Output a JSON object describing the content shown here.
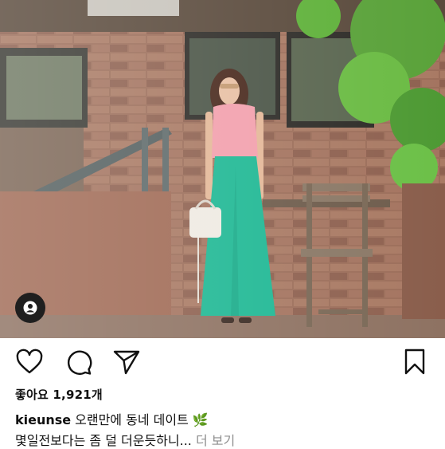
{
  "post": {
    "likes_label": "좋아요 1,921개",
    "username": "kieunse",
    "caption": "오랜만에 동네 데이트",
    "caption_emoji": "🌿",
    "caption_more": "몇일전보다는 좀 덜 더운듯하니...",
    "more_link": "더 보기"
  },
  "icons": {
    "like": "heart-icon",
    "comment": "comment-icon",
    "share": "paper-plane-icon",
    "save": "bookmark-icon",
    "tag": "user-tag-icon"
  },
  "colors": {
    "top": "#f2a0ad",
    "skirt": "#1fb894",
    "leaves": "#5fb13a",
    "brick": "#9a6b55"
  }
}
